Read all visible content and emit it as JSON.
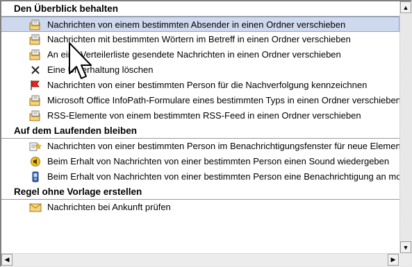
{
  "groups": [
    {
      "title": "Den Überblick behalten",
      "items": [
        {
          "label": "Nachrichten von einem bestimmten Absender in einen Ordner verschieben",
          "icon": "folder-move-icon"
        },
        {
          "label": "Nachrichten mit bestimmten Wörtern im Betreff in einen Ordner verschieben",
          "icon": "folder-move-icon"
        },
        {
          "label": "An eine Verteilerliste gesendete Nachrichten in einen Ordner verschieben",
          "icon": "folder-move-icon"
        },
        {
          "label": "Eine Unterhaltung löschen",
          "icon": "delete-x-icon"
        },
        {
          "label": "Nachrichten von einer bestimmten Person für die Nachverfolgung kennzeichnen",
          "icon": "red-flag-icon"
        },
        {
          "label": "Microsoft Office InfoPath-Formulare eines bestimmten Typs in einen Ordner verschieben",
          "icon": "folder-move-icon"
        },
        {
          "label": "RSS-Elemente von einem bestimmten RSS-Feed in einen Ordner verschieben",
          "icon": "folder-move-icon"
        }
      ]
    },
    {
      "title": "Auf dem Laufenden bleiben",
      "items": [
        {
          "label": "Nachrichten von einer bestimmten Person im Benachrichtigungsfenster für neue Elemente anzeigen",
          "icon": "alert-star-icon"
        },
        {
          "label": "Beim Erhalt von Nachrichten von einer bestimmten Person einen Sound wiedergeben",
          "icon": "speaker-icon"
        },
        {
          "label": "Beim Erhalt von Nachrichten von einer bestimmten Person eine Benachrichtigung an mobiles Gerät senden",
          "icon": "mobile-phone-icon"
        }
      ]
    },
    {
      "title": "Regel ohne Vorlage erstellen",
      "items": [
        {
          "label": "Nachrichten bei Ankunft prüfen",
          "icon": "envelope-icon"
        }
      ]
    }
  ],
  "selected": "Nachrichten von einem bestimmten Absender in einen Ordner verschieben",
  "scrollbar": {
    "up": "▲",
    "down": "▼",
    "left": "◀",
    "right": "▶"
  },
  "colors": {
    "selection": "#cfd9ee",
    "flag": "#e0281e",
    "folder": "#f5d37a"
  }
}
